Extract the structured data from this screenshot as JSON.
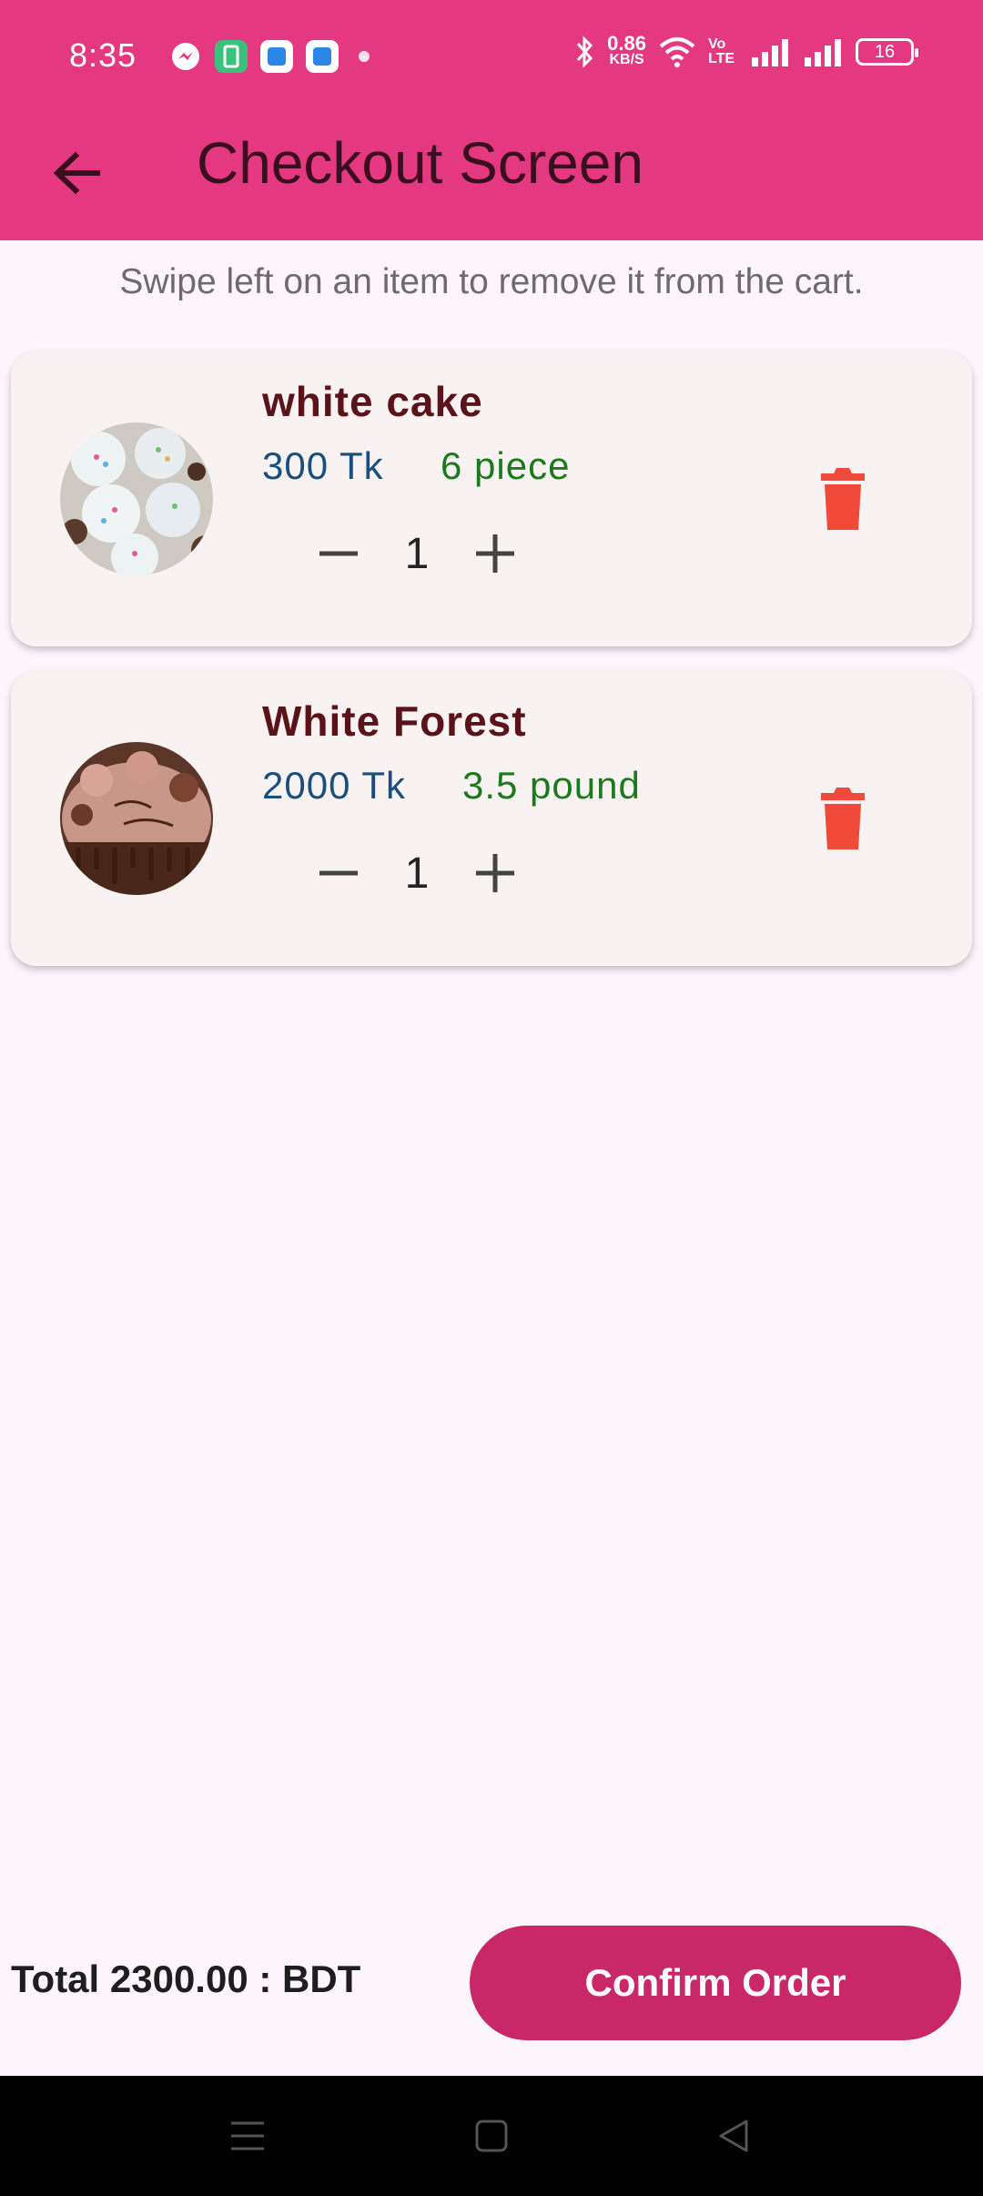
{
  "status_bar": {
    "time": "8:35",
    "net_speed_value": "0.86",
    "net_speed_unit": "KB/S",
    "volte": "Vo LTE",
    "battery": "16"
  },
  "app_bar": {
    "title": "Checkout Screen"
  },
  "hint": "Swipe left on an item to remove it from the cart.",
  "cart": {
    "items": [
      {
        "name": "white cake",
        "price": "300 Tk",
        "quantity_label": "6 piece",
        "count": "1"
      },
      {
        "name": "White Forest",
        "price": "2000 Tk",
        "quantity_label": "3.5 pound",
        "count": "1"
      }
    ]
  },
  "footer": {
    "total": "Total 2300.00 : BDT",
    "confirm_label": "Confirm Order"
  },
  "colors": {
    "app_bar": "#e43880",
    "confirm": "#c92868",
    "delete": "#f04a3a",
    "price": "#1a4f7c",
    "quantity": "#1c7a1c",
    "item_name": "#5a1319"
  }
}
